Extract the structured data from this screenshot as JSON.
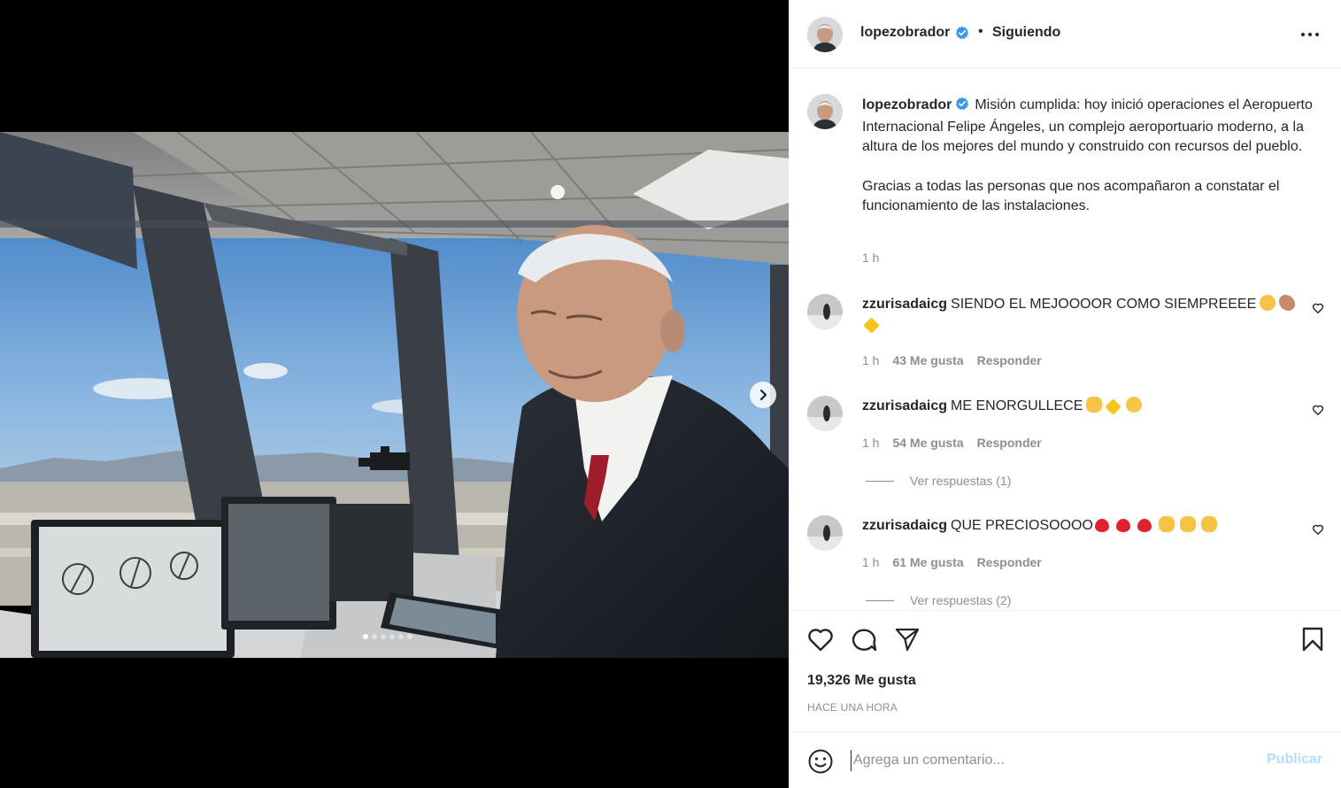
{
  "post": {
    "username": "lopezobrador",
    "header_separator": "•",
    "following_label": "Siguiendo",
    "caption_p1": "Misión cumplida: hoy inició operaciones el Aeropuerto Internacional Felipe Ángeles, un complejo aeroportuario moderno, a la altura de los mejores del mundo y construido con recursos del pueblo.",
    "caption_p2": "Gracias a todas las personas que nos acompañaron a constatar el funcionamiento de las instalaciones.",
    "caption_time": "1 h",
    "carousel_total": 6,
    "carousel_current": 1,
    "likes": "19,326 Me gusta",
    "posted_ago": "HACE UNA HORA"
  },
  "comments": [
    {
      "username": "zzurisadaicg",
      "text": "SIENDO EL MEJOOOOR COMO SIEMPREEEE",
      "emojis": [
        "star-struck-emoji",
        "flexed-biceps-emoji",
        "sparkles-emoji"
      ],
      "time": "1 h",
      "likes": "43 Me gusta",
      "reply_label": "Responder",
      "view_replies": ""
    },
    {
      "username": "zzurisadaicg",
      "text": "ME ENORGULLECE",
      "emojis": [
        "raising-hands-emoji",
        "sparkles-emoji",
        "pleading-face-emoji"
      ],
      "time": "1 h",
      "likes": "54 Me gusta",
      "reply_label": "Responder",
      "view_replies": "Ver respuestas (1)"
    },
    {
      "username": "zzurisadaicg",
      "text": "QUE PRECIOSOOOO",
      "emojis": [
        "red-heart-emoji",
        "red-heart-emoji",
        "red-heart-emoji",
        "raising-hands-emoji",
        "raising-hands-emoji",
        "raising-hands-emoji"
      ],
      "time": "1 h",
      "likes": "61 Me gusta",
      "reply_label": "Responder",
      "view_replies": "Ver respuestas (2)"
    }
  ],
  "composer": {
    "placeholder": "Agrega un comentario...",
    "publish_label": "Publicar"
  },
  "colors": {
    "verified": "#3897f0",
    "muted": "#8e8e8e",
    "publish_disabled": "#b2dffc",
    "text": "#262626"
  }
}
